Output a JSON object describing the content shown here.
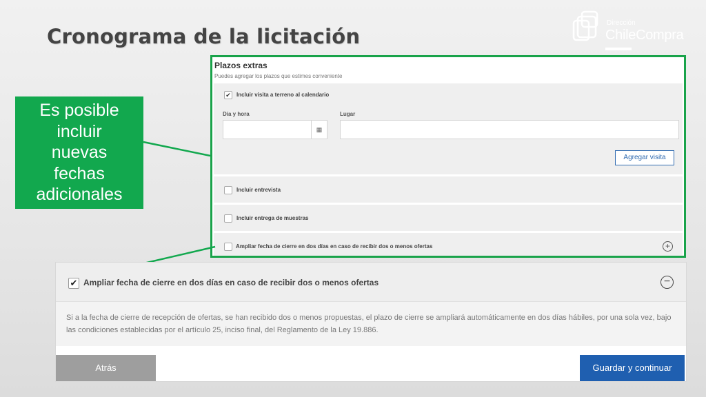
{
  "slide": {
    "title": "Cronograma de la licitación"
  },
  "logo": {
    "small": "Dirección",
    "big": "ChileCompra"
  },
  "callout": {
    "lines": [
      "Es posible",
      "incluir",
      "nuevas",
      "fechas",
      "adicionales"
    ]
  },
  "panel": {
    "title": "Plazos extras",
    "subtitle": "Puedes agregar los plazos que estimes conveniente",
    "visita": {
      "label": "Incluir visita a terreno al calendario",
      "checked": true,
      "fecha_label": "Día y hora",
      "lugar_label": "Lugar",
      "fecha_value": "",
      "lugar_value": "",
      "button": "Agregar visita"
    },
    "entrevista": {
      "label": "Incluir entrevista",
      "checked": false
    },
    "muestras": {
      "label": "Incluir entrega de muestras",
      "checked": false
    },
    "ampliar": {
      "label": "Ampliar fecha de cierre en dos días en caso de recibir dos o menos ofertas",
      "checked": false
    }
  },
  "detail": {
    "title": "Ampliar fecha de cierre en dos días en caso de recibir dos o menos ofertas",
    "checked": true,
    "text": "Si a la fecha de cierre de recepción de ofertas, se han recibido dos o menos propuestas, el plazo de cierre se ampliará automáticamente en dos días hábiles, por una sola vez, bajo las condiciones establecidas por el artículo 25, inciso final, del Reglamento de la Ley 19.886."
  },
  "buttons": {
    "atras": "Atrás",
    "guardar": "Guardar y continuar"
  },
  "colors": {
    "green": "#12a84e",
    "blue": "#1f5fb0",
    "gray": "#9e9e9e"
  },
  "icons": {
    "calendar": "calendar-icon",
    "plus": "plus-circle-icon",
    "minus": "minus-circle-icon",
    "check": "checkmark-icon"
  }
}
